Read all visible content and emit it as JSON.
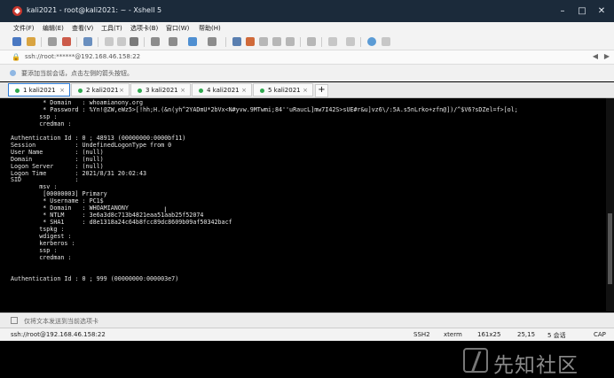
{
  "window": {
    "title": "kali2021 - root@kali2021: ~ - Xshell 5",
    "buttons": {
      "minimize": "–",
      "maximize": "□",
      "close": "✕"
    }
  },
  "menu": [
    "文件(F)",
    "编辑(E)",
    "查看(V)",
    "工具(T)",
    "选项卡(B)",
    "窗口(W)",
    "帮助(H)"
  ],
  "address": {
    "lock_icon": "🔒",
    "text": "ssh://root:******@192.168.46.158:22",
    "arrows": [
      "◀",
      "▶"
    ]
  },
  "notice": {
    "text": "要添加当前会话，点击左侧的箭头按钮。"
  },
  "tabs": [
    {
      "label": "1 kali2021",
      "close": "×",
      "active": true
    },
    {
      "label": "2 kali2021",
      "close": "×",
      "active": false
    },
    {
      "label": "3 kali2021",
      "close": "×",
      "active": false
    },
    {
      "label": "4 kali2021",
      "close": "×",
      "active": false
    },
    {
      "label": "5 kali2021",
      "close": "×",
      "active": false
    }
  ],
  "tab_add": "+",
  "terminal": {
    "lines": [
      "         * Domain   : whoamianony.org",
      "         * Password : %Yn!@ZW,eWz5>[!hh;H.(&n(yh^2YADmU*2bVx<N#yvw.9MTwmi;84''uRaucL]mw7I42S>sUE#r&u]vz6\\/:5A.s5nLrko+zfn@])/^$V6?sDZel=f>[ol;",
      "        ssp :",
      "        credman :",
      "",
      "Authentication Id : 0 ; 48913 (00000000:0000bf11)",
      "Session           : UndefinedLogonType from 0",
      "User Name         : (null)",
      "Domain            : (null)",
      "Logon Server      : (null)",
      "Logon Time        : 2021/8/31 20:02:43",
      "SID               :",
      "        msv :",
      "         [00000003] Primary",
      "         * Username : PC1$",
      "         * Domain   : WHOAMIANONY",
      "         * NTLM     : 3e6a3d8c713b4821eaa51aab25f52074",
      "         * SHA1     : d8e1318a24c64b8fcc89dc8609b09af50342bacf",
      "        tspkg :",
      "        wdigest :",
      "        kerberos :",
      "        ssp :",
      "        credman :",
      "",
      "",
      "Authentication Id : 0 ; 999 (00000000:000003e7)"
    ]
  },
  "input_bar": {
    "text": "仅将文本发送到当前选项卡"
  },
  "status": {
    "connection": "ssh://root@192.168.46.158:22",
    "protocol": "SSH2",
    "term": "xterm",
    "size": "161x25",
    "cursor": "25,15",
    "sessions": "5 会话",
    "caps": "CAP",
    "num": "NUM"
  },
  "watermark": {
    "text": "先知社区"
  },
  "colors": {
    "titlebar": "#1b2a3a",
    "accent": "#2b7bd6",
    "tab_dot": "#2fa84f",
    "terminal_bg": "#000000",
    "terminal_fg": "#e6e6e6"
  }
}
